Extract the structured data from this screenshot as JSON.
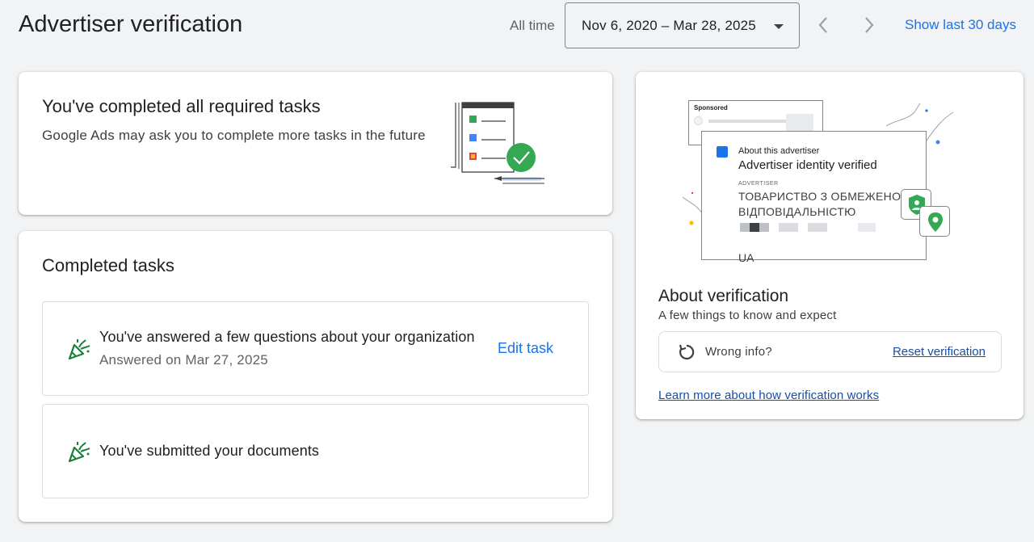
{
  "header": {
    "title": "Advertiser verification",
    "range_label": "All time",
    "date_range": "Nov 6, 2020 – Mar 28, 2025",
    "show_last": "Show last 30 days"
  },
  "summary_card": {
    "title": "You've completed all required tasks",
    "subtitle": "Google Ads may ask you to complete more tasks in the future"
  },
  "tasks_card": {
    "title": "Completed tasks",
    "tasks": [
      {
        "title": "You've answered a few questions about your organization",
        "subtitle": "Answered on Mar 27, 2025",
        "action": "Edit task"
      },
      {
        "title": "You've submitted your documents"
      }
    ]
  },
  "side_card": {
    "illustration": {
      "sponsored": "Sponsored",
      "about_advertiser": "About this advertiser",
      "identity_verified": "Advertiser identity verified",
      "advertiser_label": "ADVERTISER",
      "advertiser_name": "ТОВАРИСТВО З ОБМЕЖЕНОЮ ВІДПОВІДАЛЬНІСТЮ",
      "country": "UA"
    },
    "title": "About verification",
    "subtitle": "A few things to know and expect",
    "wrong_info": "Wrong info?",
    "reset": "Reset verification",
    "learn_more": "Learn more about how verification works"
  },
  "colors": {
    "accent": "#1a73e8",
    "success": "#34a853",
    "link": "#174ea6",
    "background": "#f1f3f4"
  }
}
